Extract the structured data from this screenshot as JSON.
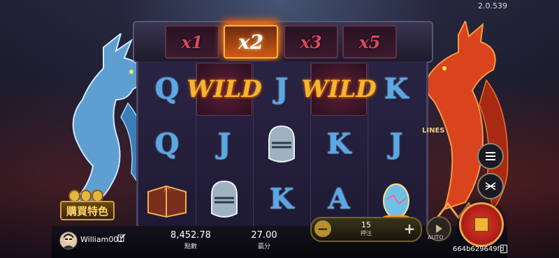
{
  "version": "2.0.539",
  "multipliers": [
    "x1",
    "x2",
    "x3",
    "x5"
  ],
  "active_multiplier": "x2",
  "reels": [
    [
      "Q",
      "Q",
      "book"
    ],
    [
      "WILD",
      "J",
      "helmet"
    ],
    [
      "J",
      "helmet",
      "K"
    ],
    [
      "WILD",
      "K",
      "A"
    ],
    [
      "K",
      "J",
      "egg"
    ]
  ],
  "lines_label": "LINES",
  "buy_feature_label": "購買特色",
  "player": {
    "username": "William001"
  },
  "balance": {
    "value": "8,452.78",
    "label": "點數"
  },
  "win": {
    "value": "27.00",
    "label": "贏分"
  },
  "bet": {
    "value": "15",
    "label": "押注"
  },
  "auto_label": "AUTO",
  "game_id": "664b629649fd",
  "colors": {
    "card_blue": "#58a8e8",
    "wild_gold": "#f3b533",
    "spin_red": "#d0291f",
    "multiplier_red": "#d94a5e"
  },
  "icons": [
    "menu-icon",
    "lines-toggle-icon",
    "edit-icon",
    "play-icon",
    "stop-icon",
    "copy-icon",
    "minus-icon",
    "plus-icon"
  ]
}
